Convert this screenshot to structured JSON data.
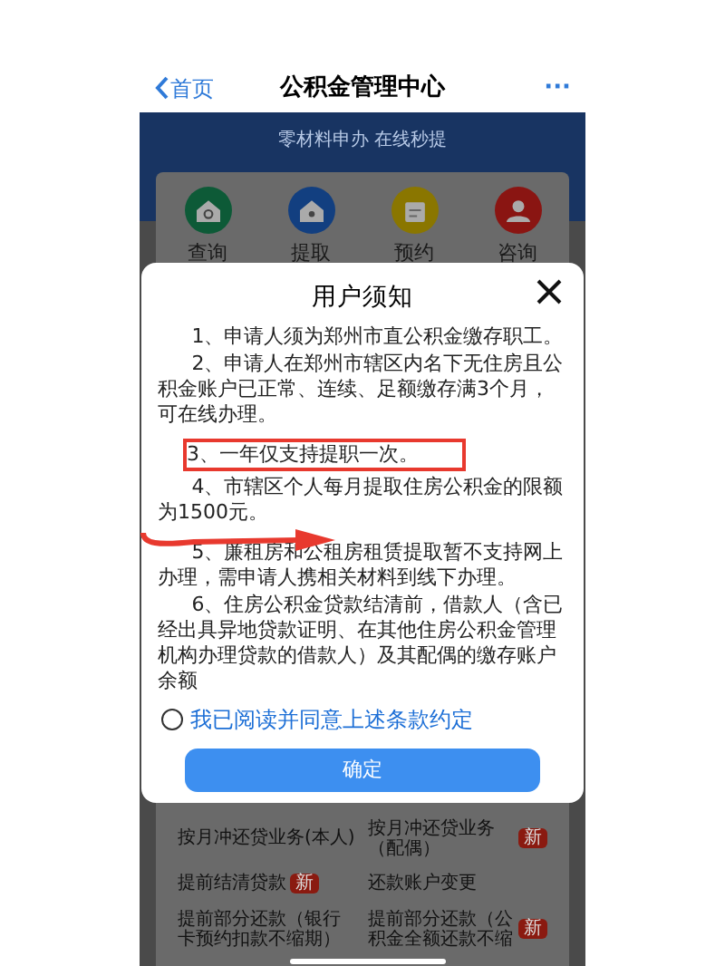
{
  "nav": {
    "back": "首页",
    "title": "公积金管理中心",
    "more": "···"
  },
  "banner": {
    "subtitle": "零材料申办 在线秒提"
  },
  "quick_actions": [
    {
      "label": "查询",
      "color": "#0d5a37"
    },
    {
      "label": "提取",
      "color": "#123f80"
    },
    {
      "label": "预约",
      "color": "#8a7600"
    },
    {
      "label": "咨询",
      "color": "#8a1512"
    }
  ],
  "modal": {
    "title": "用户须知",
    "items": [
      {
        "text": "1、申请人须为郑州市直公积金缴存职工。",
        "highlighted": false
      },
      {
        "text": "2、申请人在郑州市辖区内名下无住房且公积金账户已正常、连续、足额缴存满3个月，可在线办理。",
        "highlighted": false
      },
      {
        "text": "3、一年仅支持提职一次。",
        "highlighted": true
      },
      {
        "text": "4、市辖区个人每月提取住房公积金的限额为1500元。",
        "highlighted": false
      },
      {
        "text": "5、廉租房和公租房租赁提取暂不支持网上办理，需申请人携相关材料到线下办理。",
        "highlighted": false
      },
      {
        "text": "6、住房公积金贷款结清前，借款人（含已经出具异地贷款证明、在其他住房公积金管理机构办理贷款的借款人）及其配偶的缴存账户余额",
        "highlighted": false
      }
    ],
    "agree": {
      "label": "我已阅读并同意上述条款约定",
      "checked": false
    },
    "confirm": "确定"
  },
  "services": [
    {
      "label": "按月冲还贷业务(本人)"
    },
    {
      "label": "按月冲还贷业务（配偶）",
      "badge": "新"
    },
    {
      "label": "提前结清贷款",
      "badge": "新"
    },
    {
      "label": "还款账户变更"
    },
    {
      "label": "提前部分还款（银行卡预约扣款不缩期）"
    },
    {
      "label": "提前部分还款（公积金全额还款不缩",
      "badge": "新"
    }
  ]
}
